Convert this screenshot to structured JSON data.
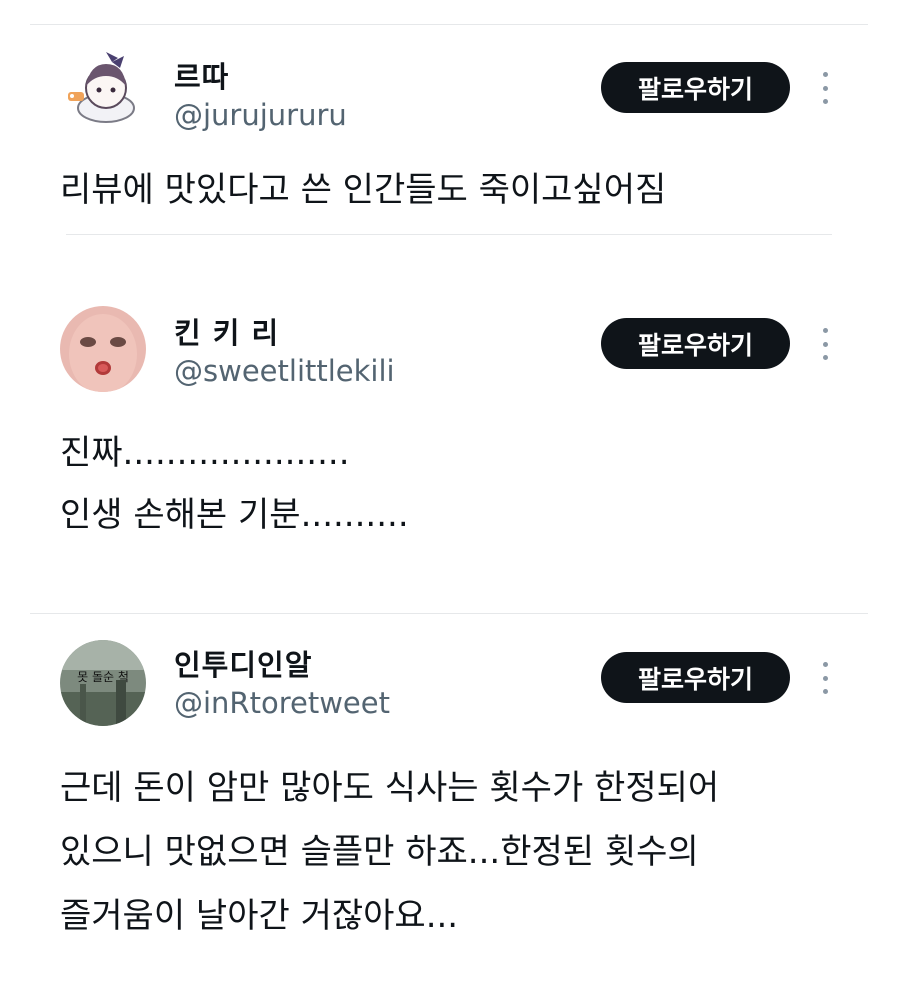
{
  "tweets": [
    {
      "display_name": "르따",
      "handle": "@jurujururu",
      "follow_label": "팔로우하기",
      "text_lines": [
        "리뷰에 맛있다고 쓴 인간들도 죽이고싶어짐"
      ]
    },
    {
      "display_name": "킨 키 리",
      "handle": "@sweetlittlekili",
      "follow_label": "팔로우하기",
      "text_lines": [
        "진짜.....................",
        "인생 손해본 기분.........."
      ]
    },
    {
      "display_name": "인투디인알",
      "handle": "@inRtoretweet",
      "follow_label": "팔로우하기",
      "text_lines": [
        "근데 돈이 암만 많아도 식사는 횟수가 한정되어",
        "있으니 맛없으면 슬플만 하죠...한정된 횟수의",
        "즐거움이 날아간 거잖아요..."
      ],
      "avatar_text": "못 돌순 척"
    }
  ],
  "colors": {
    "text": "#0f1419",
    "handle": "#536471",
    "button_bg": "#0f1419",
    "button_text": "#ffffff",
    "divider": "#e6e8ea",
    "more_icon": "#8b98a5"
  },
  "icons": {
    "more": "more-vertical-icon"
  }
}
